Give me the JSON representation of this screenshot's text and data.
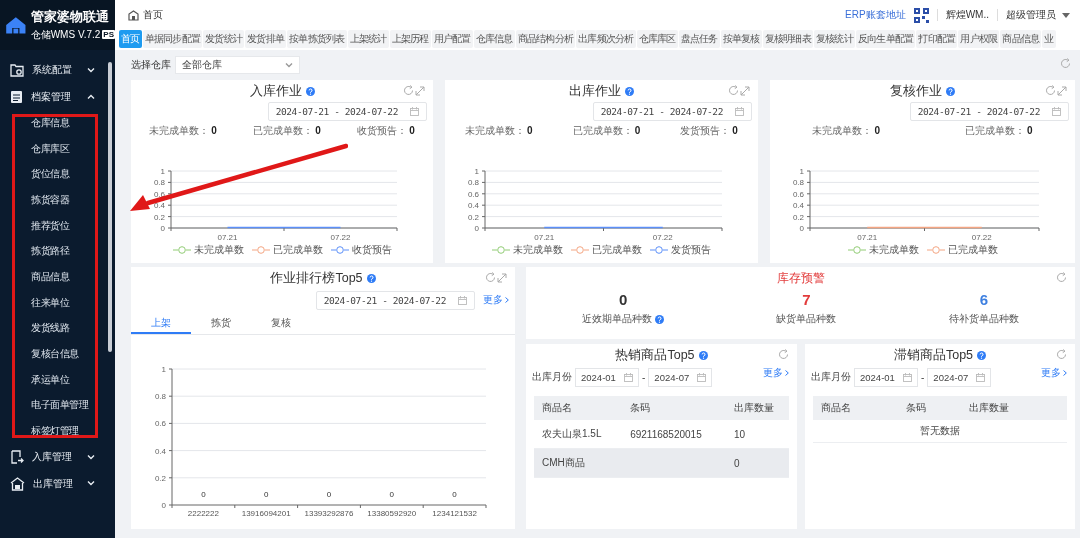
{
  "app": {
    "name": "管家婆物联通",
    "subtitle": "仓储WMS V.7.2",
    "badge": "PS"
  },
  "sidebar": {
    "items": [
      {
        "label": "系统配置",
        "expanded": false
      },
      {
        "label": "档案管理",
        "expanded": true,
        "children": [
          {
            "label": "仓库信息"
          },
          {
            "label": "仓库库区"
          },
          {
            "label": "货位信息"
          },
          {
            "label": "拣货容器"
          },
          {
            "label": "推荐货位"
          },
          {
            "label": "拣货路径"
          },
          {
            "label": "商品信息"
          },
          {
            "label": "往来单位"
          },
          {
            "label": "发货线路"
          },
          {
            "label": "复核台信息"
          },
          {
            "label": "承运单位"
          },
          {
            "label": "电子面单管理"
          },
          {
            "label": "标签灯管理"
          }
        ]
      },
      {
        "label": "入库管理",
        "expanded": false
      },
      {
        "label": "出库管理",
        "expanded": false
      }
    ]
  },
  "breadcrumb": "首页",
  "header": {
    "erp_link": "ERP账套地址",
    "account": "辉煌WM..",
    "user": "超级管理员"
  },
  "tabs": [
    {
      "label": "首页",
      "selected": true
    },
    {
      "label": "单据同步配置",
      "selected": false
    },
    {
      "label": "发货统计",
      "selected": false
    },
    {
      "label": "发货排单",
      "selected": false
    },
    {
      "label": "按单拣货列表",
      "selected": false
    },
    {
      "label": "上架统计",
      "selected": false
    },
    {
      "label": "上架历程",
      "selected": false
    },
    {
      "label": "用户配置",
      "selected": false
    },
    {
      "label": "仓库信息",
      "selected": false
    },
    {
      "label": "商品结构分析",
      "selected": false
    },
    {
      "label": "出库频次分析",
      "selected": false
    },
    {
      "label": "仓库库区",
      "selected": false
    },
    {
      "label": "盘点任务",
      "selected": false
    },
    {
      "label": "按单复核",
      "selected": false
    },
    {
      "label": "复核明细表",
      "selected": false
    },
    {
      "label": "复核统计",
      "selected": false
    },
    {
      "label": "反向生单配置",
      "selected": false
    },
    {
      "label": "打印配置",
      "selected": false
    },
    {
      "label": "用户权限",
      "selected": false
    },
    {
      "label": "商品信息",
      "selected": false
    },
    {
      "label": "业",
      "selected": false
    }
  ],
  "warehouse_filter": {
    "label": "选择仓库",
    "value": "全部仓库"
  },
  "work_panels": [
    {
      "title": "入库作业",
      "date_range": "2024-07-21 - 2024-07-22",
      "stats": [
        {
          "label": "未完成单数：",
          "value": "0"
        },
        {
          "label": "已完成单数：",
          "value": "0"
        },
        {
          "label": "收货预告：",
          "value": "0"
        }
      ],
      "chart_data": {
        "type": "line",
        "grid": true,
        "categories": [
          "07.21",
          "07.22"
        ],
        "ylim": [
          0,
          1
        ],
        "yticks": [
          0,
          0.2,
          0.4,
          0.6,
          0.8,
          1
        ],
        "series": [
          {
            "name": "未完成单数",
            "color": "#91cc75",
            "values": [
              null,
              null
            ]
          },
          {
            "name": "已完成单数",
            "color": "#f4a582",
            "values": [
              null,
              null
            ]
          },
          {
            "name": "收货预告",
            "color": "#5b8ff9",
            "values": [
              0,
              0
            ]
          }
        ]
      }
    },
    {
      "title": "出库作业",
      "date_range": "2024-07-21 - 2024-07-22",
      "stats": [
        {
          "label": "未完成单数：",
          "value": "0"
        },
        {
          "label": "已完成单数：",
          "value": "0"
        },
        {
          "label": "发货预告：",
          "value": "0"
        }
      ],
      "chart_data": {
        "type": "line",
        "grid": true,
        "categories": [
          "07.21",
          "07.22"
        ],
        "ylim": [
          0,
          1
        ],
        "yticks": [
          0,
          0.2,
          0.4,
          0.6,
          0.8,
          1
        ],
        "series": [
          {
            "name": "未完成单数",
            "color": "#91cc75",
            "values": [
              null,
              null
            ]
          },
          {
            "name": "已完成单数",
            "color": "#f4a582",
            "values": [
              null,
              null
            ]
          },
          {
            "name": "发货预告",
            "color": "#5b8ff9",
            "values": [
              0,
              0
            ]
          }
        ]
      }
    },
    {
      "title": "复核作业",
      "date_range": "2024-07-21 - 2024-07-22",
      "stats": [
        {
          "label": "未完成单数：",
          "value": "0"
        },
        {
          "label": "已完成单数：",
          "value": "0"
        }
      ],
      "chart_data": {
        "type": "line",
        "grid": true,
        "categories": [
          "07.21",
          "07.22"
        ],
        "ylim": [
          0,
          1
        ],
        "yticks": [
          0,
          0.2,
          0.4,
          0.6,
          0.8,
          1
        ],
        "series": [
          {
            "name": "未完成单数",
            "color": "#91cc75",
            "values": [
              null,
              null
            ]
          },
          {
            "name": "已完成单数",
            "color": "#f4a582",
            "values": [
              0,
              0
            ]
          }
        ]
      }
    }
  ],
  "ranking": {
    "title": "作业排行榜Top5",
    "date_range": "2024-07-21 - 2024-07-22",
    "more": "更多",
    "tabs": [
      {
        "label": "上架",
        "selected": true
      },
      {
        "label": "拣货",
        "selected": false
      },
      {
        "label": "复核",
        "selected": false
      }
    ],
    "chart_data": {
      "type": "bar",
      "grid": true,
      "categories": [
        "2222222",
        "13916094201",
        "13393292876",
        "13380592920",
        "1234121532"
      ],
      "values": [
        0,
        0,
        0,
        0,
        0
      ],
      "ylim": [
        0,
        1
      ],
      "yticks": [
        0,
        0.2,
        0.4,
        0.6,
        0.8,
        1
      ],
      "data_labels": true
    }
  },
  "stock_alert": {
    "title": "库存预警",
    "metrics": [
      {
        "value": "0",
        "label": "近效期单品种数",
        "color": "#333333",
        "help": true
      },
      {
        "value": "7",
        "label": "缺货单品种数",
        "color": "#e23b3b",
        "help": false
      },
      {
        "value": "6",
        "label": "待补货单品种数",
        "color": "#3d7fe0",
        "help": false
      }
    ]
  },
  "product_tables": [
    {
      "title": "热销商品Top5",
      "month_label": "出库月份",
      "from": "2024-01",
      "separator": "-",
      "to": "2024-07",
      "more": "更多",
      "columns": [
        "商品名",
        "条码",
        "出库数量"
      ],
      "rows": [
        {
          "name": "农夫山泉1.5L",
          "barcode": "6921168520015",
          "quantity": "10",
          "selected": false
        },
        {
          "name": "CMH商品",
          "quantity": "0",
          "selected": true
        }
      ]
    },
    {
      "title": "滞销商品Top5",
      "month_label": "出库月份",
      "from": "2024-01",
      "separator": "-",
      "to": "2024-07",
      "more": "更多",
      "columns": [
        "商品名",
        "条码",
        "出库数量"
      ],
      "empty_text": "暂无数据"
    }
  ],
  "annotations": [
    {
      "kind": "highlight-box"
    },
    {
      "kind": "arrow"
    }
  ]
}
